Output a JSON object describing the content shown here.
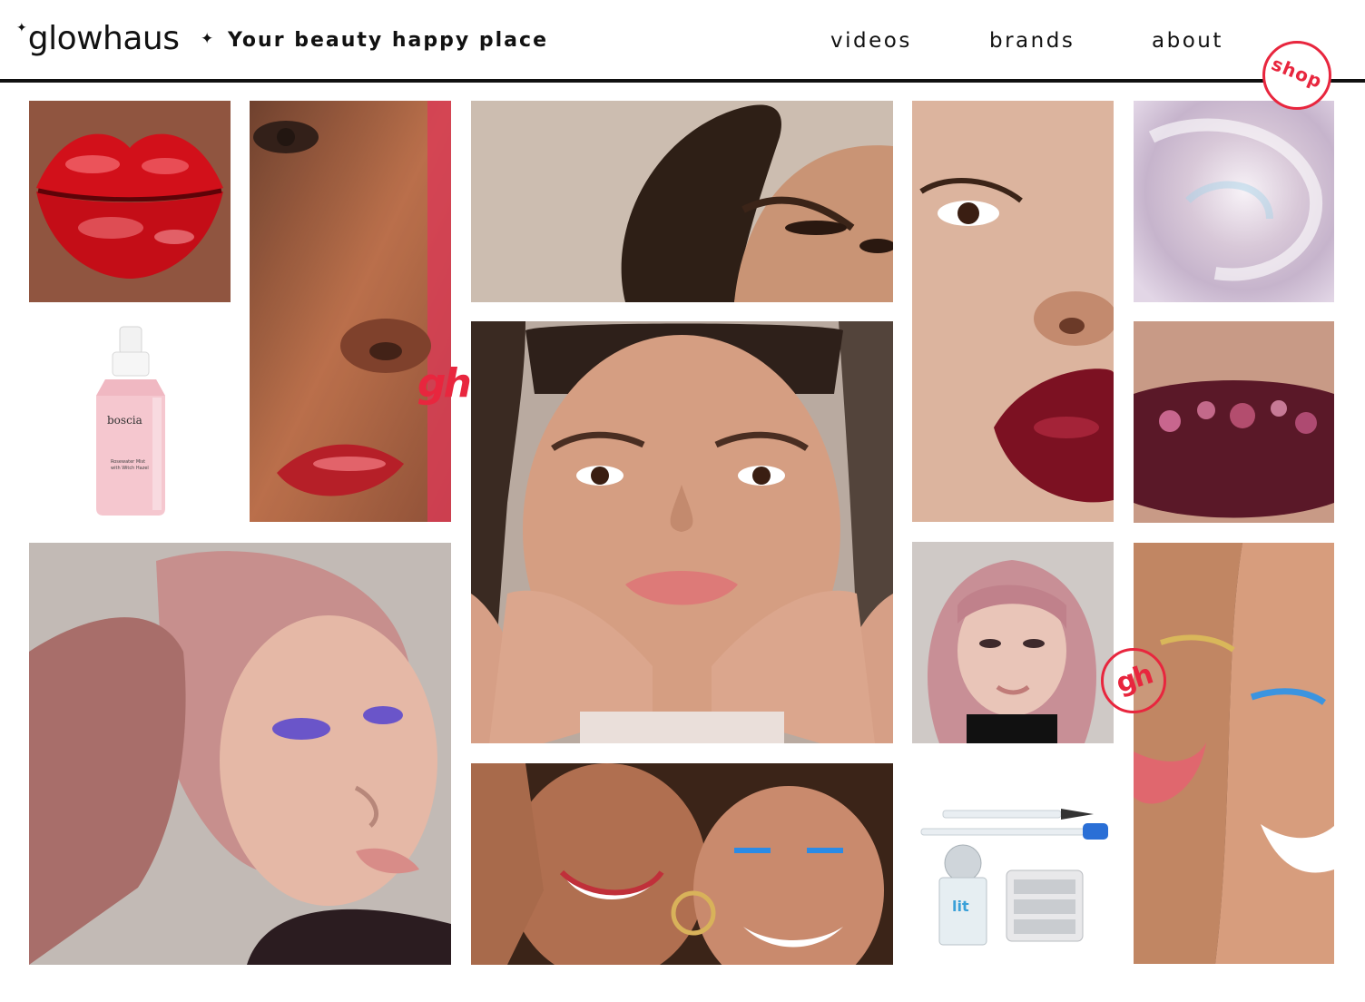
{
  "header": {
    "logo": "glowhaus",
    "logo_spark": "✦",
    "tag_spark": "✦",
    "tagline": "Your beauty happy place",
    "nav": {
      "videos": "videos",
      "brands": "brands",
      "about": "about"
    },
    "shop": "shop"
  },
  "brand_marks": {
    "gh_script": "gh",
    "gh_badge": "gh"
  },
  "product_labels": {
    "boscia_brand": "boscia",
    "boscia_line1": "Rosewater Mist",
    "boscia_line2": "with Witch Hazel",
    "lit_brand": "lit"
  },
  "colors": {
    "accent": "#e8263e",
    "ink": "#111111",
    "background": "#ffffff"
  }
}
